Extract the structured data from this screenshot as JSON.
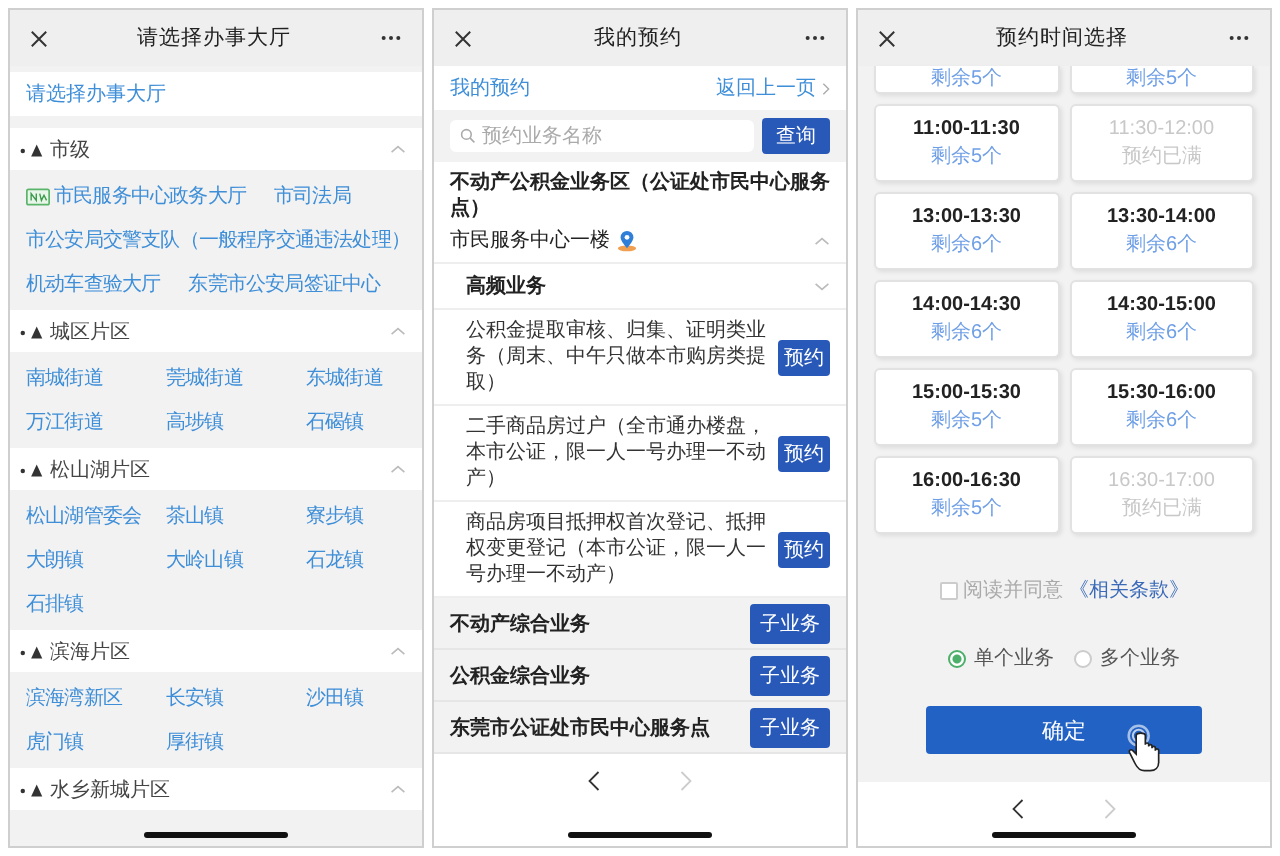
{
  "hall_screen": {
    "title": "请选择办事大厅",
    "prompt": "请选择办事大厅",
    "groups": [
      {
        "name": "市级",
        "kind": "flow",
        "items": [
          {
            "label": "市民服务中心政务大厅",
            "has_icon": true
          },
          {
            "label": "市司法局",
            "has_icon": false
          },
          {
            "label": "市公安局交警支队（一般程序交通违法处理）",
            "has_icon": false
          },
          {
            "label": "机动车查验大厅",
            "has_icon": false
          },
          {
            "label": "东莞市公安局签证中心",
            "has_icon": false
          }
        ]
      },
      {
        "name": "城区片区",
        "kind": "grid",
        "items": [
          {
            "label": "南城街道",
            "has_icon": false
          },
          {
            "label": "莞城街道",
            "has_icon": false
          },
          {
            "label": "东城街道",
            "has_icon": false
          },
          {
            "label": "万江街道",
            "has_icon": false
          },
          {
            "label": "高埗镇",
            "has_icon": false
          },
          {
            "label": "石碣镇",
            "has_icon": false
          }
        ]
      },
      {
        "name": "松山湖片区",
        "kind": "grid",
        "items": [
          {
            "label": "松山湖管委会",
            "has_icon": false
          },
          {
            "label": "茶山镇",
            "has_icon": false
          },
          {
            "label": "寮步镇",
            "has_icon": false
          },
          {
            "label": "大朗镇",
            "has_icon": false
          },
          {
            "label": "大岭山镇",
            "has_icon": false
          },
          {
            "label": "石龙镇",
            "has_icon": false
          },
          {
            "label": "石排镇",
            "has_icon": false
          }
        ]
      },
      {
        "name": "滨海片区",
        "kind": "grid",
        "items": [
          {
            "label": "滨海湾新区",
            "has_icon": false
          },
          {
            "label": "长安镇",
            "has_icon": false
          },
          {
            "label": "沙田镇",
            "has_icon": false
          },
          {
            "label": "虎门镇",
            "has_icon": false
          },
          {
            "label": "厚街镇",
            "has_icon": false
          }
        ]
      },
      {
        "name": "水乡新城片区"
      }
    ]
  },
  "booking_screen": {
    "title": "我的预约",
    "breadcrumb": "我的预约",
    "back_link": "返回上一页",
    "search": {
      "placeholder": "预约业务名称",
      "button": "查询"
    },
    "area": {
      "title": "不动产公积金业务区（公证处市民中心服务点）",
      "location": "市民服务中心一楼"
    },
    "category": "高频业务",
    "services": [
      {
        "name": "公积金提取审核、归集、证明类业务（周末、中午只做本市购房类提取）",
        "button": "预约"
      },
      {
        "name": "二手商品房过户（全市通办楼盘，本市公证，限一人一号办理一不动产）",
        "button": "预约"
      },
      {
        "name": "商品房项目抵押权首次登记、抵押权变更登记（本市公证，限一人一号办理一不动产）",
        "button": "预约"
      }
    ],
    "other_categories": [
      {
        "name": "不动产综合业务",
        "button": "子业务"
      },
      {
        "name": "公积金综合业务",
        "button": "子业务"
      },
      {
        "name": "东莞市公证处市民中心服务点",
        "button": "子业务"
      }
    ],
    "nav": {
      "prev_disabled": false,
      "next_disabled": true
    }
  },
  "time_screen": {
    "title": "预约时间选择",
    "partial_slots": [
      {
        "status": "剩余5个"
      },
      {
        "status": "剩余5个"
      }
    ],
    "slots": [
      {
        "time": "11:00-11:30",
        "status": "剩余5个",
        "available": true
      },
      {
        "time": "11:30-12:00",
        "status": "预约已满",
        "available": false
      },
      {
        "time": "13:00-13:30",
        "status": "剩余6个",
        "available": true
      },
      {
        "time": "13:30-14:00",
        "status": "剩余6个",
        "available": true
      },
      {
        "time": "14:00-14:30",
        "status": "剩余6个",
        "available": true
      },
      {
        "time": "14:30-15:00",
        "status": "剩余6个",
        "available": true
      },
      {
        "time": "15:00-15:30",
        "status": "剩余5个",
        "available": true
      },
      {
        "time": "15:30-16:00",
        "status": "剩余6个",
        "available": true
      },
      {
        "time": "16:00-16:30",
        "status": "剩余5个",
        "available": true
      },
      {
        "time": "16:30-17:00",
        "status": "预约已满",
        "available": false
      }
    ],
    "agreement": {
      "text": "阅读并同意",
      "link": "《相关条款》",
      "checked": false
    },
    "modes": [
      {
        "label": "单个业务",
        "selected": true
      },
      {
        "label": "多个业务",
        "selected": false
      }
    ],
    "confirm": "确定",
    "nav": {
      "prev_disabled": false,
      "next_disabled": true
    }
  }
}
